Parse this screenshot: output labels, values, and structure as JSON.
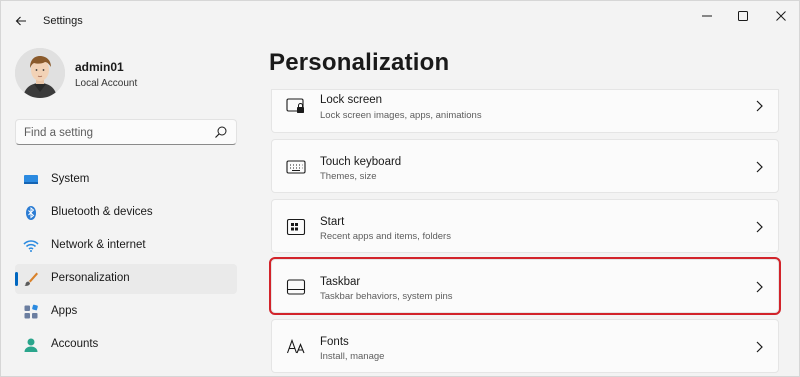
{
  "window": {
    "title": "Settings",
    "controls": [
      "minimize",
      "maximize",
      "close"
    ]
  },
  "profile": {
    "name": "admin01",
    "account_type": "Local Account"
  },
  "search": {
    "placeholder": "Find a setting"
  },
  "sidebar": {
    "items": [
      {
        "label": "System",
        "icon": "monitor-icon"
      },
      {
        "label": "Bluetooth & devices",
        "icon": "bluetooth-icon"
      },
      {
        "label": "Network & internet",
        "icon": "wifi-icon"
      },
      {
        "label": "Personalization",
        "icon": "brush-icon",
        "active": true
      },
      {
        "label": "Apps",
        "icon": "apps-icon"
      },
      {
        "label": "Accounts",
        "icon": "person-icon"
      }
    ]
  },
  "main": {
    "title": "Personalization",
    "cards": [
      {
        "title": "Lock screen",
        "subtitle": "Lock screen images, apps, animations",
        "icon": "lock-screen-icon"
      },
      {
        "title": "Touch keyboard",
        "subtitle": "Themes, size",
        "icon": "keyboard-icon"
      },
      {
        "title": "Start",
        "subtitle": "Recent apps and items, folders",
        "icon": "start-icon"
      },
      {
        "title": "Taskbar",
        "subtitle": "Taskbar behaviors, system pins",
        "icon": "taskbar-icon",
        "highlighted": true
      },
      {
        "title": "Fonts",
        "subtitle": "Install, manage",
        "icon": "fonts-icon"
      }
    ]
  },
  "colors": {
    "accent": "#0067c0",
    "highlight_border": "#d2232a",
    "background": "#f3f3f3",
    "card": "#fbfbfb"
  }
}
